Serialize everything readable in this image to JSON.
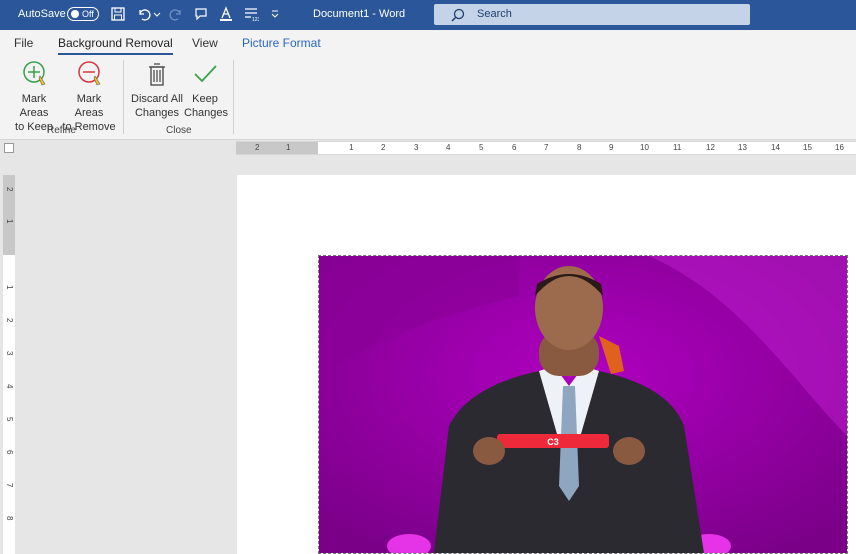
{
  "titlebar": {
    "autosave_label": "AutoSave",
    "autosave_state": "Off",
    "document_title": "Document1  -  Word",
    "search_placeholder": "Search"
  },
  "tabs": [
    {
      "label": "File"
    },
    {
      "label": "Background Removal",
      "active": true
    },
    {
      "label": "View"
    },
    {
      "label": "Picture Format"
    }
  ],
  "ribbon": {
    "refine": {
      "label": "Refine",
      "mark_keep": [
        "Mark Areas",
        "to Keep"
      ],
      "mark_remove": [
        "Mark Areas",
        "to Remove"
      ]
    },
    "close": {
      "label": "Close",
      "discard": [
        "Discard All",
        "Changes"
      ],
      "keep": [
        "Keep",
        "Changes"
      ]
    }
  },
  "ruler": {
    "horizontal": [
      "2",
      "1",
      "1",
      "2",
      "3",
      "4",
      "5",
      "6",
      "7",
      "8",
      "9",
      "10",
      "11",
      "12",
      "13",
      "14",
      "15",
      "16"
    ],
    "vertical": [
      "2",
      "1",
      "1",
      "2",
      "3",
      "4",
      "5",
      "6",
      "7",
      "8"
    ]
  },
  "picture": {
    "label": "C3",
    "colors": {
      "magenta": "#9a00a8",
      "deep_magenta": "#7a0088",
      "suit": "#2a2a30"
    }
  },
  "colors": {
    "accent": "#2b579a",
    "ribbon_bg": "#f3f3f3"
  }
}
